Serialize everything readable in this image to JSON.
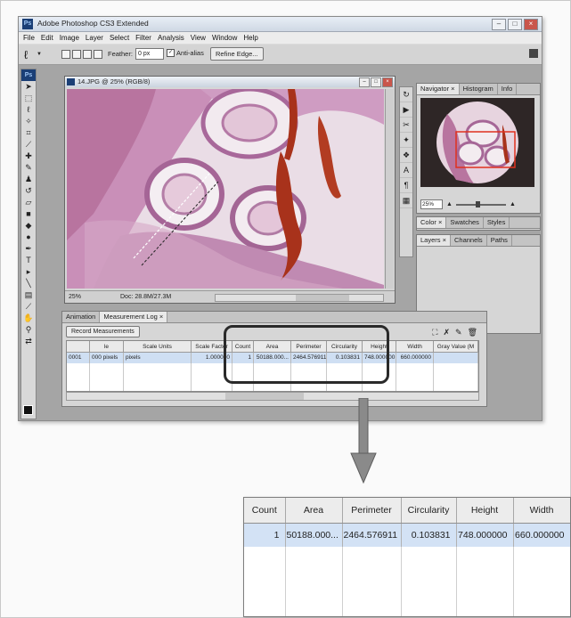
{
  "window": {
    "title": "Adobe Photoshop CS3 Extended",
    "app_badge": "Ps",
    "controls": [
      "–",
      "□",
      "×"
    ]
  },
  "menu": [
    "File",
    "Edit",
    "Image",
    "Layer",
    "Select",
    "Filter",
    "Analysis",
    "View",
    "Window",
    "Help"
  ],
  "options_bar": {
    "feather_label": "Feather:",
    "feather_value": "0 px",
    "antialias_label": "Anti-alias",
    "antialias_checked": true,
    "refine_edge_label": "Refine Edge..."
  },
  "document": {
    "title": "14.JPG @ 25% (RGB/8)",
    "zoom": "25%",
    "doc_size": "Doc: 28.8M/27.3M"
  },
  "navigator_panel": {
    "tabs": [
      "Navigator ×",
      "Histogram",
      "Info"
    ],
    "zoom": "25%"
  },
  "color_panel": {
    "tabs": [
      "Color ×",
      "Swatches",
      "Styles"
    ]
  },
  "layers_panel": {
    "tabs": [
      "Layers ×",
      "Channels",
      "Paths"
    ]
  },
  "measurement_log": {
    "tabs": [
      "Animation",
      "Measurement Log ×"
    ],
    "record_button": "Record Measurements",
    "headers": [
      "",
      "le",
      "Scale Units",
      "Scale Factor",
      "Count",
      "Area",
      "Perimeter",
      "Circularity",
      "Height",
      "Width",
      "Gray Value (M"
    ],
    "row": [
      "0001",
      "000 pixels",
      "pixels",
      "1.000000",
      "1",
      "50188.000...",
      "2464.576911",
      "0.103831",
      "748.000000",
      "660.000000",
      ""
    ]
  },
  "zoomed_table": {
    "headers": [
      "Count",
      "Area",
      "Perimeter",
      "Circularity",
      "Height",
      "Width"
    ],
    "row": [
      "1",
      "50188.000...",
      "2464.576911",
      "0.103831",
      "748.000000",
      "660.000000"
    ]
  },
  "colors": {
    "selected_row": "#d3e2f5",
    "tissue_pink": "#c98fb8",
    "tissue_dark": "#8b4f7e",
    "blood_red": "#a8321b",
    "highlight_border": "#2a2a2a",
    "arrow": "#8a8a8a"
  }
}
